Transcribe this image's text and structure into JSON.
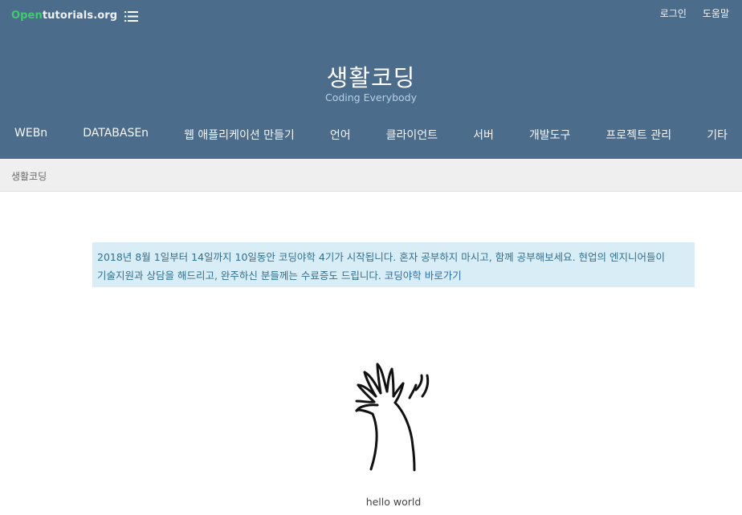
{
  "header": {
    "logo_open": "Open",
    "logo_rest": "tutorials.org",
    "login": "로그인",
    "help": "도움말",
    "title": "생활코딩",
    "subtitle": "Coding Everybody"
  },
  "nav": {
    "items": [
      "WEBn",
      "DATABASEn",
      "웹 애플리케이션 만들기",
      "언어",
      "클라이언트",
      "서버",
      "개발도구",
      "프로젝트 관리",
      "기타"
    ]
  },
  "breadcrumb": {
    "label": "생활코딩"
  },
  "notice": {
    "text": "2018년 8월 1일부터 14일까지 10일동안 코딩야학 4기가 시작됩니다. 혼자 공부하지 마시고, 함께 공부해보세요. 현업의 엔지니어들이 기술지원과 상담을 해드리고, 완주하신 분들께는 수료증도 드립니다. ",
    "link": "코딩야학 바로가기"
  },
  "hero": {
    "caption": "hello world"
  },
  "colors": {
    "header_bg": "#4c6c8c",
    "logo_accent": "#3ecc6d",
    "notice_bg": "#d9edf7",
    "notice_text": "#31708f"
  },
  "icons": {
    "menu": "list-icon",
    "hero": "waving-hand-icon"
  }
}
